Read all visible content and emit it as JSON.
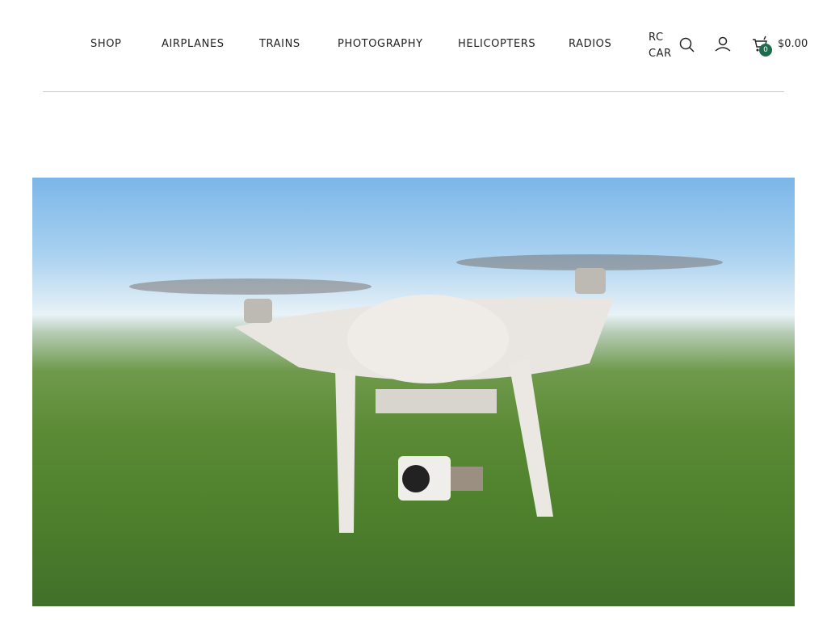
{
  "nav": {
    "items": [
      {
        "label": "SHOP"
      },
      {
        "label": "AIRPLANES"
      },
      {
        "label": "TRAINS"
      },
      {
        "label": "PHOTOGRAPHY"
      },
      {
        "label": "HELICOPTERS"
      },
      {
        "label": "RADIOS"
      },
      {
        "label": "RC CAR"
      }
    ]
  },
  "cart": {
    "count": "0",
    "total": "$0.00"
  },
  "icons": {
    "search": "search-icon",
    "account": "user-icon",
    "cart": "cart-icon"
  },
  "colors": {
    "badge": "#1f6b4e"
  }
}
